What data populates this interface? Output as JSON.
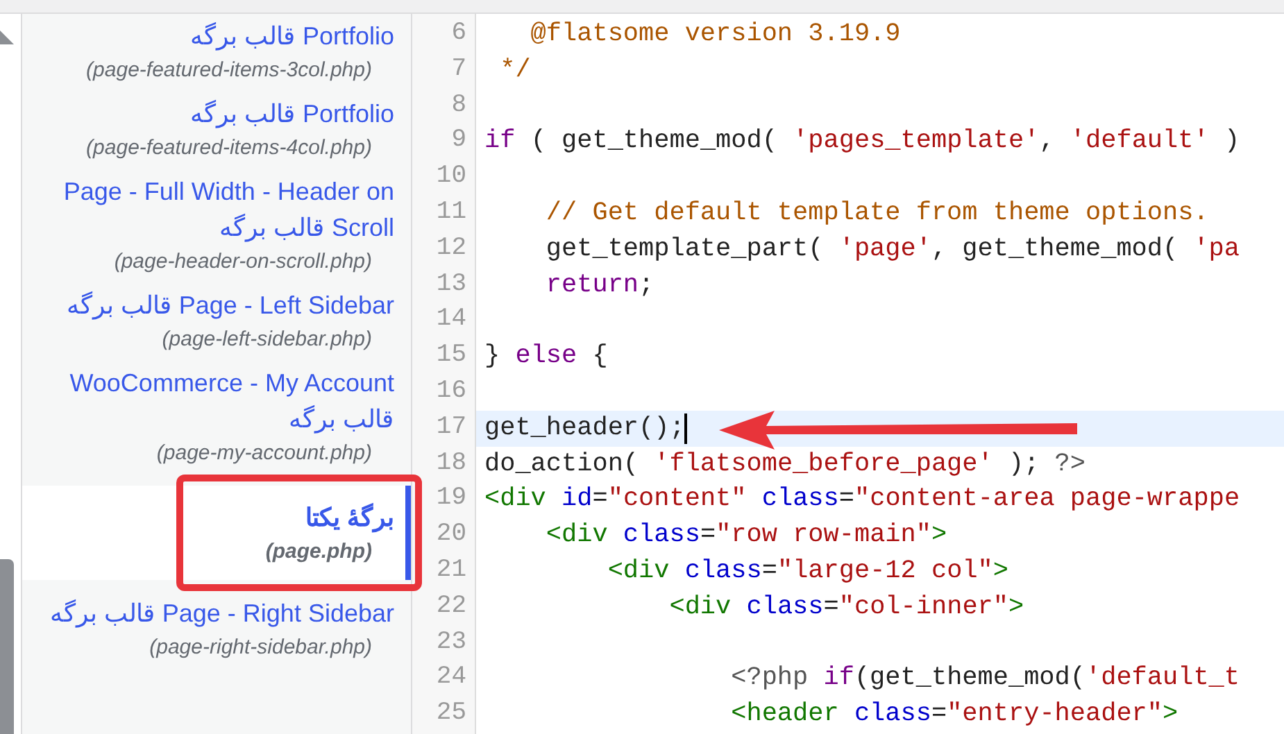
{
  "templates": [
    {
      "title": "Portfolio قالب برگه",
      "file": "(page-featured-items-3col.php)",
      "selected": false
    },
    {
      "title": "Portfolio قالب برگه",
      "file": "(page-featured-items-4col.php)",
      "selected": false
    },
    {
      "title": "Page - Full Width - Header on Scroll قالب برگه",
      "file": "(page-header-on-scroll.php)",
      "selected": false
    },
    {
      "title": "Page - Left Sidebar قالب برگه",
      "file": "(page-left-sidebar.php)",
      "selected": false
    },
    {
      "title": "WooCommerce - My Account قالب برگه",
      "file": "(page-my-account.php)",
      "selected": false
    },
    {
      "title": "برگهٔ یکتا",
      "file": "(page.php)",
      "selected": true
    },
    {
      "title": "Page - Right Sidebar قالب برگه",
      "file": "(page-right-sidebar.php)",
      "selected": false
    }
  ],
  "code": {
    "lines": [
      {
        "number": "6",
        "highlighted": false,
        "cursor": false,
        "tokens": [
          {
            "text": "   @flatsome version 3.19.9",
            "kind": "comment"
          }
        ]
      },
      {
        "number": "7",
        "highlighted": false,
        "cursor": false,
        "tokens": [
          {
            "text": " */",
            "kind": "comment"
          }
        ]
      },
      {
        "number": "8",
        "highlighted": false,
        "cursor": false
      },
      {
        "number": "9",
        "highlighted": false,
        "cursor": false,
        "tokens": [
          {
            "text": "if",
            "kind": "keyword"
          },
          {
            "text": " ( get_theme_mod( ",
            "kind": "plain"
          },
          {
            "text": "'pages_template'",
            "kind": "string"
          },
          {
            "text": ", ",
            "kind": "plain"
          },
          {
            "text": "'default'",
            "kind": "string"
          },
          {
            "text": " )",
            "kind": "plain"
          }
        ]
      },
      {
        "number": "10",
        "highlighted": false,
        "cursor": false
      },
      {
        "number": "11",
        "highlighted": false,
        "cursor": false,
        "tokens": [
          {
            "text": "    // Get default template from theme options.",
            "kind": "comment"
          }
        ]
      },
      {
        "number": "12",
        "highlighted": false,
        "cursor": false,
        "tokens": [
          {
            "text": "    get_template_part( ",
            "kind": "plain"
          },
          {
            "text": "'page'",
            "kind": "string"
          },
          {
            "text": ", get_theme_mod( ",
            "kind": "plain"
          },
          {
            "text": "'pa",
            "kind": "string"
          }
        ]
      },
      {
        "number": "13",
        "highlighted": false,
        "cursor": false,
        "tokens": [
          {
            "text": "    return",
            "kind": "keyword"
          },
          {
            "text": ";",
            "kind": "plain"
          }
        ]
      },
      {
        "number": "14",
        "highlighted": false,
        "cursor": false
      },
      {
        "number": "15",
        "highlighted": false,
        "cursor": false,
        "tokens": [
          {
            "text": "} ",
            "kind": "plain"
          },
          {
            "text": "else",
            "kind": "keyword"
          },
          {
            "text": " {",
            "kind": "plain"
          }
        ]
      },
      {
        "number": "16",
        "highlighted": false,
        "cursor": false
      },
      {
        "number": "17",
        "highlighted": true,
        "cursor": true,
        "tokens": [
          {
            "text": "get_header();",
            "kind": "plain"
          }
        ]
      },
      {
        "number": "18",
        "highlighted": false,
        "cursor": false,
        "tokens": [
          {
            "text": "do_action( ",
            "kind": "plain"
          },
          {
            "text": "'flatsome_before_page'",
            "kind": "string"
          },
          {
            "text": " ); ",
            "kind": "plain"
          },
          {
            "text": "?>",
            "kind": "meta"
          }
        ]
      },
      {
        "number": "19",
        "highlighted": false,
        "cursor": false,
        "tokens": [
          {
            "text": "<div",
            "kind": "tag"
          },
          {
            "text": " id",
            "kind": "attr"
          },
          {
            "text": "=",
            "kind": "plain"
          },
          {
            "text": "\"content\"",
            "kind": "string"
          },
          {
            "text": " class",
            "kind": "attr"
          },
          {
            "text": "=",
            "kind": "plain"
          },
          {
            "text": "\"content-area page-wrappe",
            "kind": "string"
          }
        ]
      },
      {
        "number": "20",
        "highlighted": false,
        "cursor": false,
        "tokens": [
          {
            "text": "    <div",
            "kind": "tag"
          },
          {
            "text": " class",
            "kind": "attr"
          },
          {
            "text": "=",
            "kind": "plain"
          },
          {
            "text": "\"row row-main\"",
            "kind": "string"
          },
          {
            "text": ">",
            "kind": "tag"
          }
        ]
      },
      {
        "number": "21",
        "highlighted": false,
        "cursor": false,
        "tokens": [
          {
            "text": "        <div",
            "kind": "tag"
          },
          {
            "text": " class",
            "kind": "attr"
          },
          {
            "text": "=",
            "kind": "plain"
          },
          {
            "text": "\"large-12 col\"",
            "kind": "string"
          },
          {
            "text": ">",
            "kind": "tag"
          }
        ]
      },
      {
        "number": "22",
        "highlighted": false,
        "cursor": false,
        "tokens": [
          {
            "text": "            <div",
            "kind": "tag"
          },
          {
            "text": " class",
            "kind": "attr"
          },
          {
            "text": "=",
            "kind": "plain"
          },
          {
            "text": "\"col-inner\"",
            "kind": "string"
          },
          {
            "text": ">",
            "kind": "tag"
          }
        ]
      },
      {
        "number": "23",
        "highlighted": false,
        "cursor": false
      },
      {
        "number": "24",
        "highlighted": false,
        "cursor": false,
        "tokens": [
          {
            "text": "                <?php",
            "kind": "meta"
          },
          {
            "text": " if",
            "kind": "keyword"
          },
          {
            "text": "(get_theme_mod(",
            "kind": "plain"
          },
          {
            "text": "'default_t",
            "kind": "string"
          }
        ]
      },
      {
        "number": "25",
        "highlighted": false,
        "cursor": false,
        "tokens": [
          {
            "text": "                <header",
            "kind": "tag"
          },
          {
            "text": " class",
            "kind": "attr"
          },
          {
            "text": "=",
            "kind": "plain"
          },
          {
            "text": "\"entry-header\"",
            "kind": "string"
          },
          {
            "text": ">",
            "kind": "tag"
          }
        ]
      }
    ]
  }
}
